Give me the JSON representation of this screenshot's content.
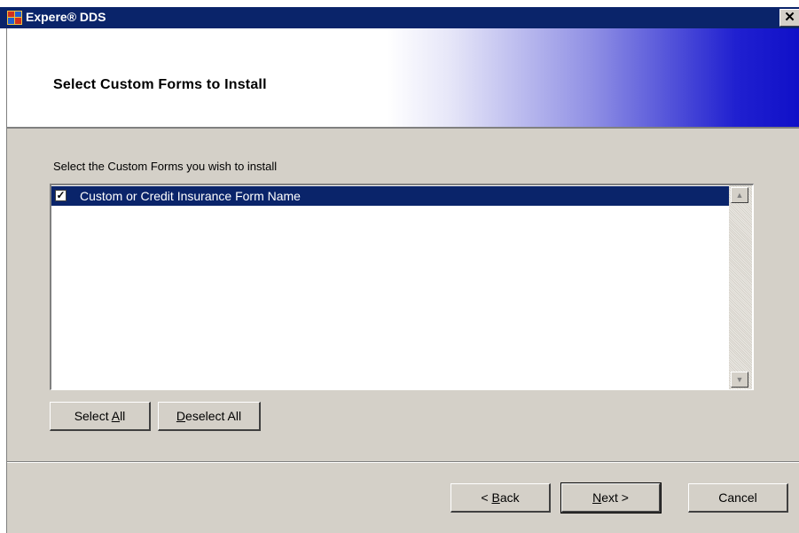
{
  "window": {
    "title": "Expere® DDS",
    "close_glyph": "✕",
    "icon": "app-icon"
  },
  "banner": {
    "title": "Select Custom Forms to Install"
  },
  "main": {
    "instruction": "Select the Custom Forms you wish to install",
    "list_items": [
      {
        "label": "Custom or Credit Insurance Form Name",
        "checked": true,
        "check_glyph": "✓"
      }
    ],
    "scroll_up_glyph": "▲",
    "scroll_down_glyph": "▼",
    "select_all": {
      "before": "Select ",
      "mnemonic": "A",
      "after": "ll"
    },
    "deselect_all": {
      "before": "",
      "mnemonic": "D",
      "after": "eselect All"
    }
  },
  "footer": {
    "back": {
      "before": "< ",
      "mnemonic": "B",
      "after": "ack"
    },
    "next": {
      "before": "",
      "mnemonic": "N",
      "after": "ext >"
    },
    "cancel": "Cancel"
  },
  "colors": {
    "titlebar": "#0a246a",
    "selection": "#0a246a",
    "face": "#d4d0c8",
    "banner_gradient_end": "#1010c8"
  }
}
